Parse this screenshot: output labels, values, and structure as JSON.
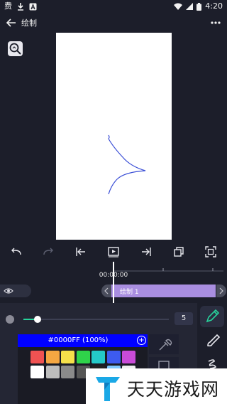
{
  "status_bar": {
    "left_icons": [
      "chinese-char-icon",
      "download-icon",
      "a-badge-icon"
    ],
    "left_glyph": "费",
    "time": "4:20"
  },
  "app_bar": {
    "title": "绘制"
  },
  "timeline": {
    "timecode": "00:00:00",
    "clip_label": "绘制 1"
  },
  "brush": {
    "size_value": "5",
    "size_fraction": 0.05
  },
  "color_picker": {
    "current_hex_label": "#0000FF (100%)",
    "current_color": "#0000FF",
    "palette_row1": [
      "#f05252",
      "#f5a742",
      "#f5e04a",
      "#2fd34a",
      "#24c9c9",
      "#3d5bf0",
      "#c94bd8"
    ],
    "palette_row2": [
      "#ffffff",
      "#bdbdbd",
      "#8a8a8a",
      "#555555",
      "#222222",
      "#7ec8ff",
      "#f0f0f0"
    ]
  },
  "watermark": {
    "text": "天天游戏网"
  },
  "colors": {
    "background": "#1c1e2a",
    "accent": "#27d39b",
    "clip": "#a98ee0",
    "stroke": "#3b4fd6"
  }
}
